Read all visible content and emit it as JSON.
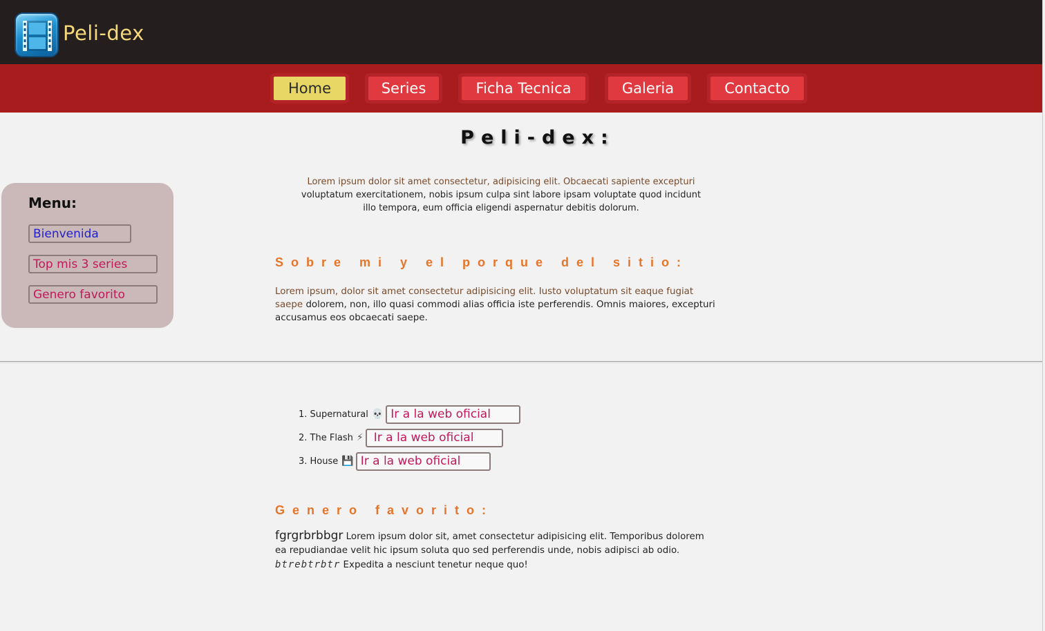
{
  "header": {
    "title": "Peli-dex",
    "logo_icon": "film-strip-icon"
  },
  "nav": {
    "items": [
      {
        "label": "Home",
        "active": true
      },
      {
        "label": "Series",
        "active": false
      },
      {
        "label": "Ficha Tecnica",
        "active": false
      },
      {
        "label": "Galeria",
        "active": false
      },
      {
        "label": "Contacto",
        "active": false
      }
    ],
    "active_color": "#e8d765",
    "item_color": "#e0393f",
    "bar_color": "#a81c1e"
  },
  "main": {
    "title": "Peli-dex:",
    "intro_line1": "Lorem ipsum dolor sit amet consectetur, adipisicing elit. Obcaecati sapiente excepturi",
    "intro_rest": "voluptatum exercitationem, nobis ipsum culpa sint labore ipsam voluptate quod incidunt illo tempora, eum officia eligendi aspernatur debitis dolorum.",
    "about_heading": "Sobre mi y el porque del sitio:",
    "about_line1": "Lorem ipsum, dolor sit amet consectetur adipisicing elit. Iusto voluptatum sit eaque fugiat saepe",
    "about_rest": "dolorem, non, illo quasi commodi alias officia iste perferendis. Omnis maiores, excepturi accusamus eos obcaecati saepe.",
    "heading_color": "#e5752a"
  },
  "side_menu": {
    "title": "Menu:",
    "links": [
      "Bienvenida",
      "Top mis 3 series",
      "Genero favorito"
    ]
  },
  "top_series": {
    "items": [
      {
        "label": "1. Supernatural",
        "icon": "skull-icon",
        "glyph": "💀",
        "button": "Ir a la web oficial"
      },
      {
        "label": "2. The Flash",
        "icon": "lightning-icon",
        "glyph": "⚡",
        "button": "Ir a la web oficial"
      },
      {
        "label": "3. House",
        "icon": "floppy-disk-icon",
        "glyph": "💾",
        "button": "Ir a la web oficial"
      }
    ]
  },
  "genre": {
    "heading": "Genero favorito:",
    "big_text": "fgrgrbrbbgr",
    "text1": " Lorem ipsum dolor sit, amet consectetur adipisicing elit. Temporibus dolorem ea repudiandae velit hic ipsum soluta quo sed perferendis unde, nobis adipisci ab odio.",
    "mono_text": "btrebtrbtr",
    "text2": " Expedita a nesciunt tenetur neque quo!"
  }
}
